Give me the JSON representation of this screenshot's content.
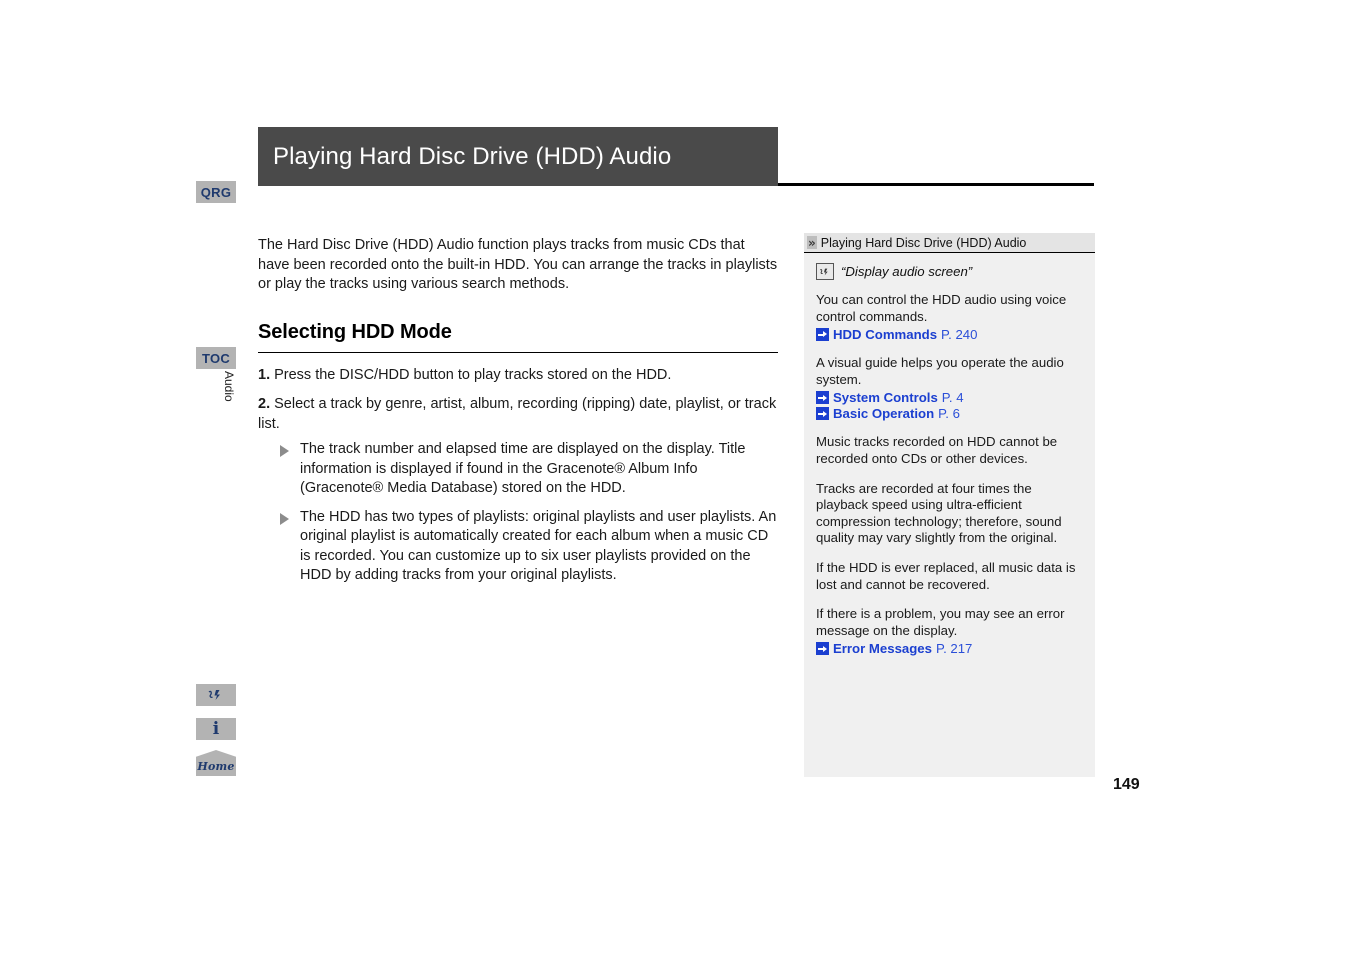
{
  "page": {
    "title": "Playing Hard Disc Drive (HDD) Audio",
    "folio": "149"
  },
  "rail": {
    "qrg_label": "QRG",
    "toc_label": "TOC",
    "section_label": "Audio",
    "info_glyph": "i",
    "home_label": "Home"
  },
  "main": {
    "intro": "The Hard Disc Drive (HDD) Audio function plays tracks from music CDs that have been recorded onto the built-in HDD. You can arrange the tracks in playlists or play the tracks using various search methods.",
    "section_heading": "Selecting HDD Mode",
    "steps": [
      {
        "num": "1.",
        "text": " Press the DISC/HDD button to play tracks stored on the HDD.",
        "subs": []
      },
      {
        "num": "2.",
        "text": " Select a track by genre, artist, album, recording (ripping) date, playlist, or track list.",
        "subs": [
          "The track number and elapsed time are displayed on the display. Title information is displayed if found in the Gracenote® Album Info (Gracenote® Media Database) stored on the HDD.",
          "The HDD has two types of playlists: original playlists and user playlists. An original playlist is automatically created for each album when a music CD is recorded. You can customize up to six user playlists provided on the HDD by adding tracks from your original playlists."
        ]
      }
    ]
  },
  "panel": {
    "header": "Playing Hard Disc Drive (HDD) Audio",
    "voice_command": "“Display audio screen”",
    "notes": [
      {
        "kind": "text-with-refs",
        "text": "You can control the HDD audio using voice control commands.",
        "refs": [
          {
            "name": "HDD Commands",
            "page": "P. 240"
          }
        ]
      },
      {
        "kind": "text-with-refs",
        "text": "A visual guide helps you operate the audio system.",
        "refs": [
          {
            "name": "System Controls",
            "page": "P. 4"
          },
          {
            "name": "Basic Operation",
            "page": "P. 6"
          }
        ]
      },
      {
        "kind": "text",
        "text": "Music tracks recorded on HDD cannot be recorded onto CDs or other devices.",
        "refs": []
      },
      {
        "kind": "text",
        "text": "Tracks are recorded at four times the playback speed using ultra-efficient compression technology; therefore, sound quality may vary slightly from the original.",
        "refs": []
      },
      {
        "kind": "text",
        "text": "If the HDD is ever replaced, all music data is lost and cannot be recovered.",
        "refs": []
      },
      {
        "kind": "text-with-refs",
        "text": "If there is a problem, you may see an error message on the display.",
        "refs": [
          {
            "name": "Error Messages",
            "page": "P. 217"
          }
        ]
      }
    ]
  },
  "colors": {
    "title_bar": "#4a4a4a",
    "tab_chip": "#b3b3b3",
    "tab_text": "#1f3a6e",
    "panel_bg": "#f0f0f0",
    "panel_head_bg": "#e4e4e4",
    "link_blue": "#1b3fd0"
  }
}
